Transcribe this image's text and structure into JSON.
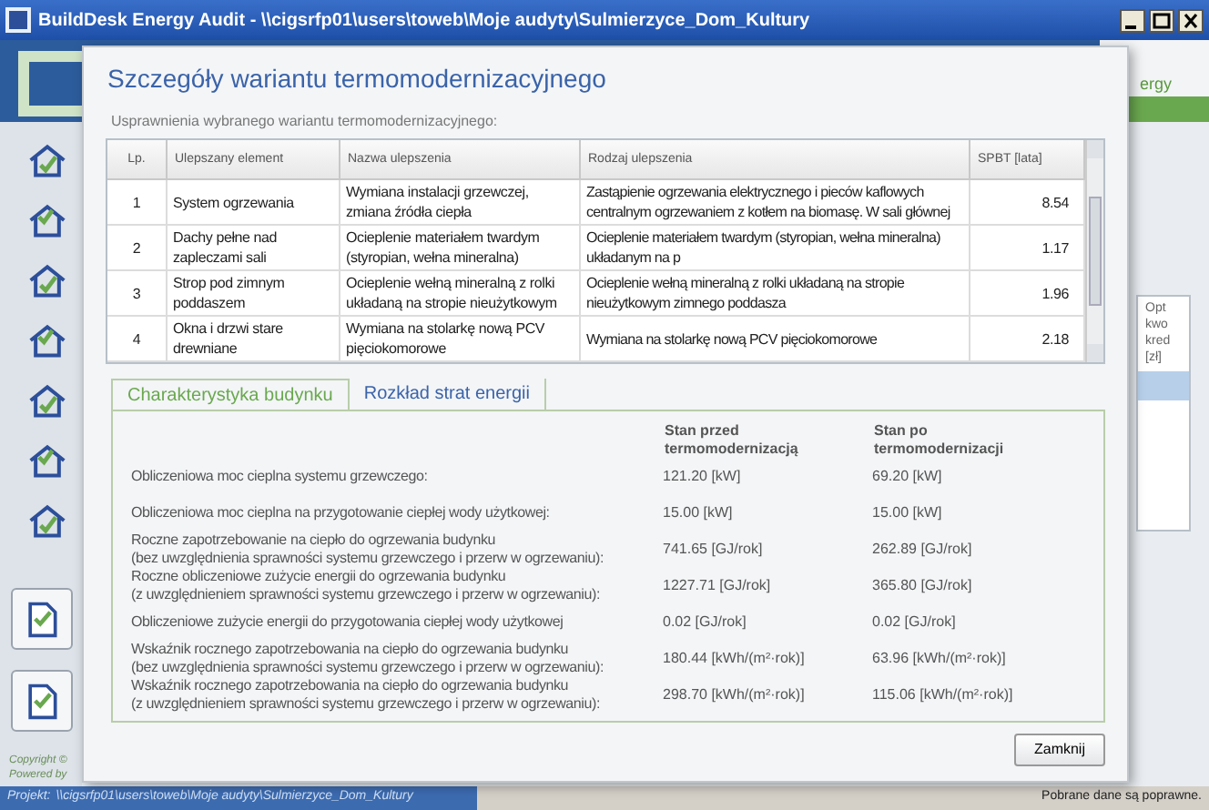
{
  "window": {
    "title": "BuildDesk Energy Audit - \\\\cigsrfp01\\users\\toweb\\Moje audyty\\Sulmierzyce_Dom_Kultury"
  },
  "background": {
    "logo_fragment": "ergy",
    "sidebar_footer": [
      "Copyright ©",
      "Powered by"
    ],
    "right_column_header": [
      "Opt",
      "kwo",
      "kred",
      "[zł]"
    ]
  },
  "dialog": {
    "title": "Szczegóły wariantu termomodernizacyjnego",
    "table_caption": "Usprawnienia wybranego wariantu termomodernizacyjnego:",
    "table": {
      "columns": [
        "Lp.",
        "Ulepszany element",
        "Nazwa ulepszenia",
        "Rodzaj ulepszenia",
        "SPBT [lata]"
      ],
      "rows": [
        {
          "cells": [
            "1",
            "System ogrzewania",
            "Wymiana instalacji grzewczej, zmiana źródła ciepła",
            "Zastąpienie ogrzewania elektrycznego i pieców kaflowych centralnym ogrzewaniem z kotłem na biomasę. W sali głównej",
            "8.54"
          ]
        },
        {
          "cells": [
            "2",
            "Dachy pełne nad zapleczami sali",
            "Ocieplenie materiałem twardym (styropian, wełna mineralna)",
            "Ocieplenie materiałem twardym (styropian, wełna mineralna) układanym na p",
            "1.17"
          ]
        },
        {
          "cells": [
            "3",
            "Strop pod zimnym poddaszem",
            "Ocieplenie wełną mineralną z rolki układaną na stropie nieużytkowym",
            "Ocieplenie wełną mineralną z rolki układaną na stropie nieużytkowym zimnego poddasza",
            "1.96"
          ]
        },
        {
          "cells": [
            "4",
            "Okna i drzwi stare drewniane",
            "Wymiana na stolarkę nową PCV pięciokomorowe",
            "Wymiana na stolarkę nową PCV pięciokomorowe",
            "2.18"
          ]
        }
      ]
    },
    "tabs": [
      {
        "label": "Charakterystyka budynku",
        "selected": true
      },
      {
        "label": "Rozkład strat energii",
        "selected": false
      }
    ],
    "panel": {
      "columns": [
        "Stan przed termomodernizacją",
        "Stan po termomodernizacji"
      ],
      "rows": [
        {
          "label": [
            "Obliczeniowa moc cieplna systemu grzewczego:"
          ],
          "before": "121.20 [kW]",
          "after": "69.20 [kW]"
        },
        {
          "label": [
            "Obliczeniowa moc cieplna na przygotowanie ciepłej wody użytkowej:"
          ],
          "before": "15.00 [kW]",
          "after": "15.00 [kW]"
        },
        {
          "label": [
            "Roczne zapotrzebowanie na ciepło do ogrzewania budynku",
            "(bez uwzględnienia sprawności systemu grzewczego i przerw w ogrzewaniu):"
          ],
          "before": "741.65 [GJ/rok]",
          "after": "262.89 [GJ/rok]"
        },
        {
          "label": [
            "Roczne obliczeniowe zużycie energii do ogrzewania budynku",
            "(z uwzględnieniem sprawności systemu grzewczego i przerw w ogrzewaniu):"
          ],
          "before": "1227.71 [GJ/rok]",
          "after": "365.80 [GJ/rok]"
        },
        {
          "label": [
            "Obliczeniowe zużycie energii do przygotowania ciepłej wody użytkowej"
          ],
          "before": "0.02 [GJ/rok]",
          "after": "0.02 [GJ/rok]"
        },
        {
          "label": [
            "Wskaźnik rocznego zapotrzebowania na ciepło do ogrzewania budynku",
            "(bez uwzględnienia sprawności systemu grzewczego i przerw w ogrzewaniu):"
          ],
          "before": "180.44 [kWh/(m²·rok)]",
          "after": "63.96 [kWh/(m²·rok)]"
        },
        {
          "label": [
            "Wskaźnik rocznego zapotrzebowania na ciepło do ogrzewania budynku",
            "(z uwzględnieniem sprawności systemu grzewczego i przerw w ogrzewaniu):"
          ],
          "before": "298.70 [kWh/(m²·rok)]",
          "after": "115.06 [kWh/(m²·rok)]"
        }
      ]
    },
    "close_button": "Zamknij"
  },
  "status_bar": {
    "project_label": "Projekt:",
    "path": "\\\\cigsrfp01\\users\\toweb\\Moje audyty\\Sulmierzyce_Dom_Kultury",
    "message": "Pobrane dane są poprawne."
  }
}
